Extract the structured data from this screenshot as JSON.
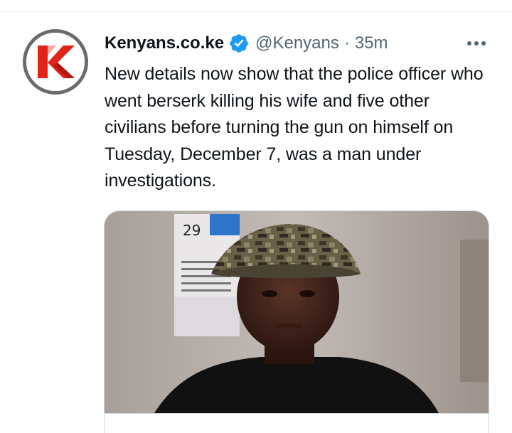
{
  "tweet": {
    "display_name": "Kenyans.co.ke",
    "handle": "@Kenyans",
    "separator": "·",
    "time": "35m",
    "text": "New details now show that the police officer who went berserk killing his wife and five other civilians before turning the gun on himself on Tuesday, December 7, was a man under investigations.",
    "avatar_icon": "kenyans-logo-icon",
    "verified_icon": "verified-badge-icon",
    "more_icon": "more-options-icon",
    "colors": {
      "verified": "#1d9bf0",
      "brand_red": "#e2231a",
      "secondary_text": "#536471"
    }
  },
  "card": {
    "image_alt": "photo of a man wearing a camouflage bucket hat",
    "calendar_number": "29"
  }
}
